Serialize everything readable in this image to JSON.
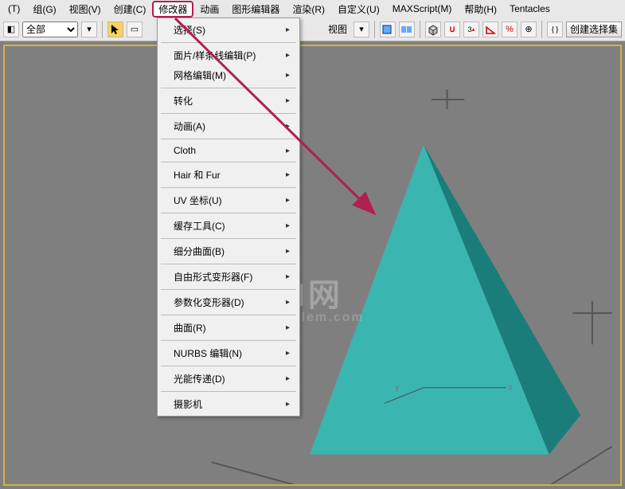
{
  "menubar": {
    "items": [
      {
        "label": "(T)"
      },
      {
        "label": "组(G)"
      },
      {
        "label": "视图(V)"
      },
      {
        "label": "创建(C)"
      },
      {
        "label": "修改器",
        "highlighted": true
      },
      {
        "label": "动画"
      },
      {
        "label": "图形编辑器"
      },
      {
        "label": "渲染(R)"
      },
      {
        "label": "自定义(U)"
      },
      {
        "label": "MAXScript(M)"
      },
      {
        "label": "帮助(H)"
      },
      {
        "label": "Tentacles"
      }
    ]
  },
  "toolbar": {
    "selector_value": "全部",
    "view_label": "视图",
    "create_set_placeholder": "创建选择集"
  },
  "dropdown": {
    "items": [
      {
        "label": "选择(S)",
        "arrow": true
      },
      {
        "sep": true
      },
      {
        "label": "面片/样条线编辑(P)",
        "arrow": true
      },
      {
        "label": "网格编辑(M)",
        "arrow": true
      },
      {
        "sep": true
      },
      {
        "label": "转化",
        "arrow": true
      },
      {
        "sep": true
      },
      {
        "label": "动画(A)",
        "arrow": true
      },
      {
        "sep": true
      },
      {
        "label": "Cloth",
        "arrow": true
      },
      {
        "sep": true
      },
      {
        "label": "Hair 和 Fur",
        "arrow": true
      },
      {
        "sep": true
      },
      {
        "label": "UV 坐标(U)",
        "arrow": true
      },
      {
        "sep": true
      },
      {
        "label": "缓存工具(C)",
        "arrow": true
      },
      {
        "sep": true
      },
      {
        "label": "细分曲面(B)",
        "arrow": true
      },
      {
        "sep": true
      },
      {
        "label": "自由形式变形器(F)",
        "arrow": true
      },
      {
        "sep": true
      },
      {
        "label": "参数化变形器(D)",
        "arrow": true
      },
      {
        "sep": true
      },
      {
        "label": "曲面(R)",
        "arrow": true
      },
      {
        "sep": true
      },
      {
        "label": "NURBS 编辑(N)",
        "arrow": true
      },
      {
        "sep": true
      },
      {
        "label": "光能传递(D)",
        "arrow": true
      },
      {
        "sep": true
      },
      {
        "label": "摄影机",
        "arrow": true
      }
    ]
  },
  "watermark": {
    "main": "GXI网",
    "sub": "gxlem.com"
  },
  "colors": {
    "pyramid_front": "#3ab5b0",
    "pyramid_side": "#1a7d7a",
    "accent_arrow": "#b02050",
    "viewport_bg": "#7f7f7f",
    "viewport_border": "#d8b040"
  }
}
